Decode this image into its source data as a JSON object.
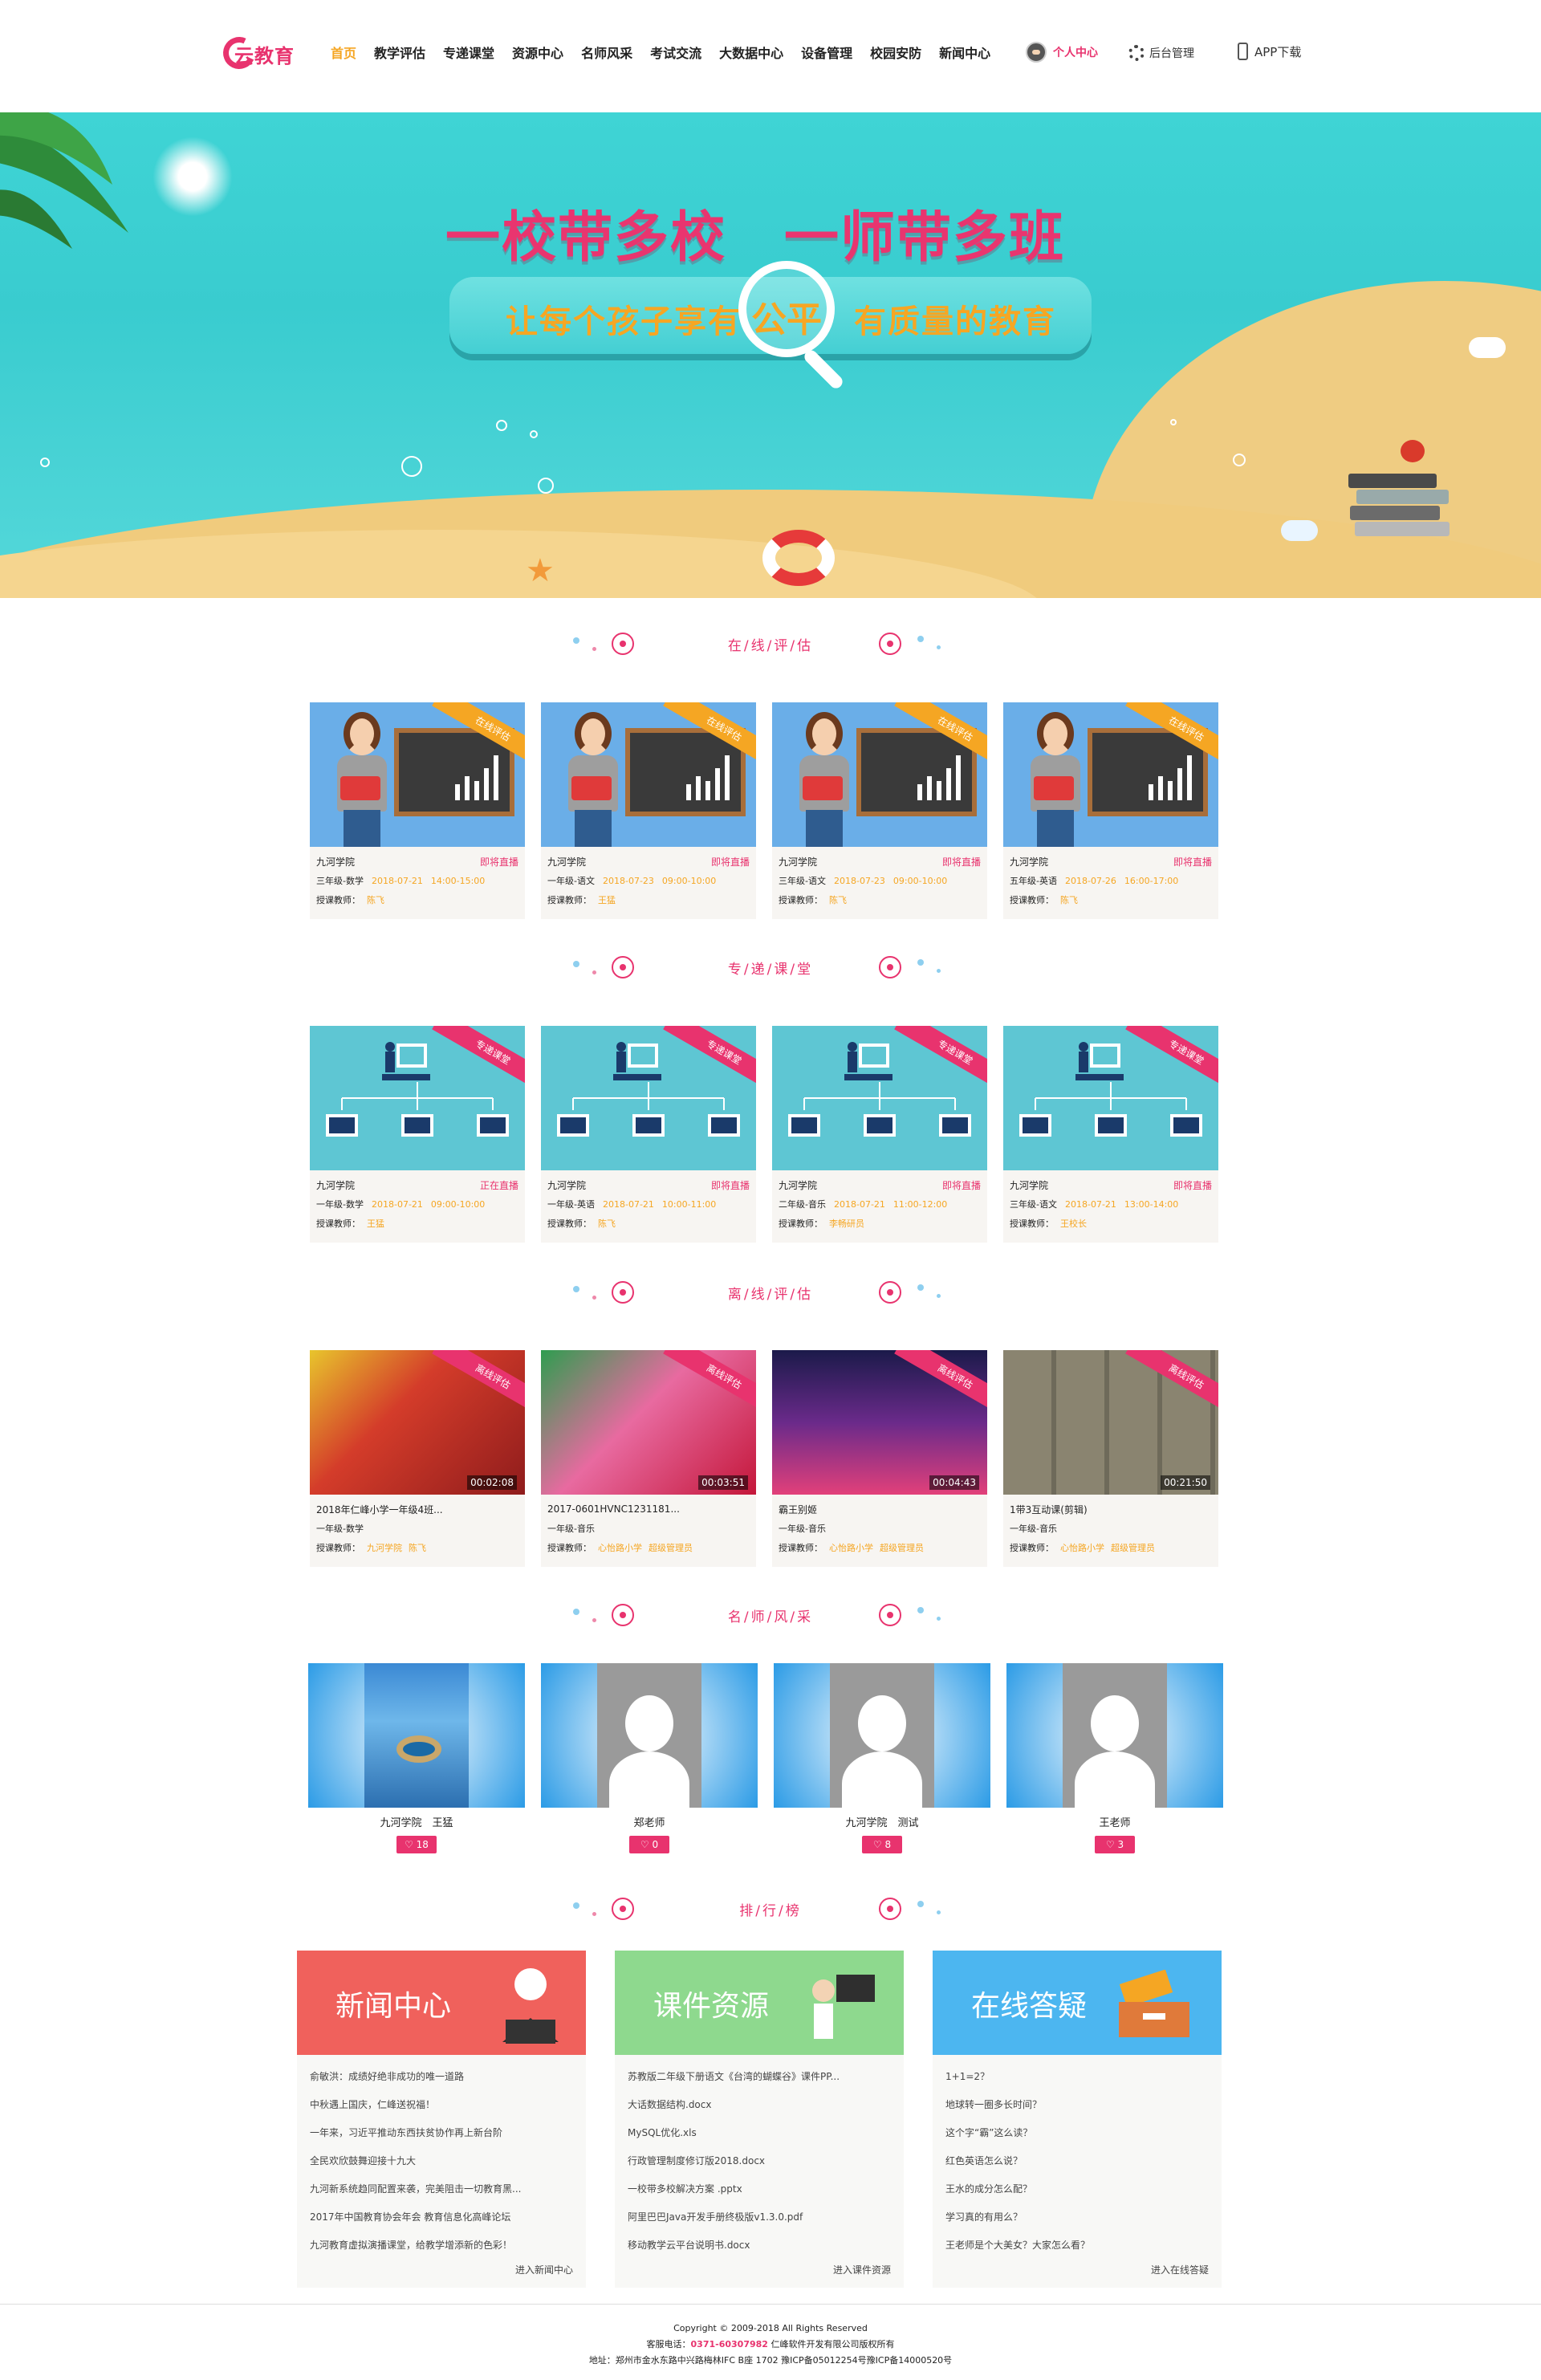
{
  "nav": {
    "logo": "云教育",
    "menu": [
      "首页",
      "教学评估",
      "专递课堂",
      "资源中心",
      "名师风采",
      "考试交流",
      "大数据中心",
      "设备管理",
      "校园安防",
      "新闻中心"
    ],
    "active_index": 0,
    "user_label": "个人中心",
    "admin_label": "后台管理",
    "app_label": "APP下载"
  },
  "banner": {
    "slogan_left": "一校带多校",
    "slogan_right": "一师带多班",
    "sub_left": "让每个孩子享有",
    "sub_mid": "公平",
    "sub_right": "有质量的教育"
  },
  "sections": {
    "online": "在/线/评/估",
    "remote": "专/递/课/堂",
    "offline": "离/线/评/估",
    "teachers": "名/师/风/采",
    "ranking": "排/行/榜"
  },
  "online_cards": [
    {
      "school": "九河学院",
      "status": "即将直播",
      "grade": "三年级-数学",
      "date": "2018-07-21",
      "time": "14:00-15:00",
      "teacher_label": "授课教师：",
      "teacher": "陈飞",
      "ribbon": "在线评估"
    },
    {
      "school": "九河学院",
      "status": "即将直播",
      "grade": "一年级-语文",
      "date": "2018-07-23",
      "time": "09:00-10:00",
      "teacher_label": "授课教师：",
      "teacher": "王猛",
      "ribbon": "在线评估"
    },
    {
      "school": "九河学院",
      "status": "即将直播",
      "grade": "三年级-语文",
      "date": "2018-07-23",
      "time": "09:00-10:00",
      "teacher_label": "授课教师：",
      "teacher": "陈飞",
      "ribbon": "在线评估"
    },
    {
      "school": "九河学院",
      "status": "即将直播",
      "grade": "五年级-英语",
      "date": "2018-07-26",
      "time": "16:00-17:00",
      "teacher_label": "授课教师：",
      "teacher": "陈飞",
      "ribbon": "在线评估"
    }
  ],
  "remote_cards": [
    {
      "school": "九河学院",
      "status": "正在直播",
      "grade": "一年级-数学",
      "date": "2018-07-21",
      "time": "09:00-10:00",
      "teacher_label": "授课教师：",
      "teacher": "王猛",
      "ribbon": "专递课堂"
    },
    {
      "school": "九河学院",
      "status": "即将直播",
      "grade": "一年级-英语",
      "date": "2018-07-21",
      "time": "10:00-11:00",
      "teacher_label": "授课教师：",
      "teacher": "陈飞",
      "ribbon": "专递课堂"
    },
    {
      "school": "九河学院",
      "status": "即将直播",
      "grade": "二年级-音乐",
      "date": "2018-07-21",
      "time": "11:00-12:00",
      "teacher_label": "授课教师：",
      "teacher": "李畅研员",
      "ribbon": "专递课堂"
    },
    {
      "school": "九河学院",
      "status": "即将直播",
      "grade": "三年级-语文",
      "date": "2018-07-21",
      "time": "13:00-14:00",
      "teacher_label": "授课教师：",
      "teacher": "王校长",
      "ribbon": "专递课堂"
    }
  ],
  "offline_cards": [
    {
      "title": "2018年仁峰小学一年级4班...",
      "duration": "00:02:08",
      "grade": "一年级-数学",
      "teacher_label": "授课教师：",
      "school": "九河学院",
      "teacher": "陈飞",
      "ribbon": "离线评估"
    },
    {
      "title": "2017-0601HVNC1231181...",
      "duration": "00:03:51",
      "grade": "一年级-音乐",
      "teacher_label": "授课教师：",
      "school": "心怡路小学",
      "teacher": "超级管理员",
      "ribbon": "离线评估"
    },
    {
      "title": "霸王别姬",
      "duration": "00:04:43",
      "grade": "一年级-音乐",
      "teacher_label": "授课教师：",
      "school": "心怡路小学",
      "teacher": "超级管理员",
      "ribbon": "离线评估"
    },
    {
      "title": "1带3互动课(剪辑)",
      "duration": "00:21:50",
      "grade": "一年级-音乐",
      "teacher_label": "授课教师：",
      "school": "心怡路小学",
      "teacher": "超级管理员",
      "ribbon": "离线评估"
    }
  ],
  "teachers": [
    {
      "name": "九河学院　王猛",
      "count": "18"
    },
    {
      "name": "郑老师",
      "count": "0"
    },
    {
      "name": "九河学院　测试",
      "count": "8"
    },
    {
      "name": "王老师",
      "count": "3"
    }
  ],
  "ranking": {
    "news": {
      "title": "新闻中心",
      "color": "#f0615c",
      "items": [
        "俞敏洪：成绩好绝非成功的唯一道路",
        "中秋遇上国庆，仁峰送祝福！",
        "一年来，习近平推动东西扶贫协作再上新台阶",
        "全民欢欣鼓舞迎接十九大",
        "九河新系统趋同配置来袭，完美阻击一切教育黑...",
        "2017年中国教育协会年会 教育信息化高峰论坛",
        "九河教育虚拟演播课堂，给教学增添新的色彩！"
      ],
      "more": "进入新闻中心"
    },
    "courseware": {
      "title": "课件资源",
      "color": "#8ed98e",
      "items": [
        "苏教版二年级下册语文《台湾的蝴蝶谷》课件PP...",
        "大话数据结构.docx",
        "MySQL优化.xls",
        "行政管理制度修订版2018.docx",
        "一校带多校解决方案 .pptx",
        "阿里巴巴Java开发手册终极版v1.3.0.pdf",
        "移动教学云平台说明书.docx"
      ],
      "more": "进入课件资源"
    },
    "qa": {
      "title": "在线答疑",
      "color": "#4cb6f0",
      "items": [
        "1+1=2？",
        "地球转一圈多长时间？",
        "这个字“霸”这么读？",
        "红色英语怎么说？",
        "王水的成分怎么配？",
        "学习真的有用么？",
        "王老师是个大美女？大家怎么看？"
      ],
      "more": "进入在线答疑"
    }
  },
  "footer": {
    "copyright": "Copyright © 2009-2018 All Rights Reserved",
    "hotline_label": "客服电话：",
    "hotline": "0371-60307982",
    "company": "仁峰软件开发有限公司版权所有",
    "address": "地址：郑州市金水东路中兴路梅林IFC B座 1702  豫ICP备05012254号豫ICP备14000520号"
  },
  "colors": {
    "accent": "#e8336e",
    "orange": "#f5a623",
    "teal": "#5ec6d3"
  }
}
